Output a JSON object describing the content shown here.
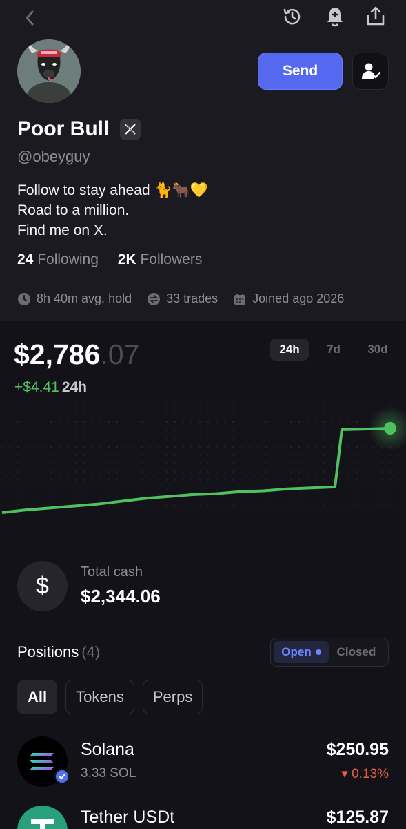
{
  "header": {
    "back_icon": "chevron-left-icon",
    "history_icon": "history-icon",
    "notify_icon": "bell-plus-icon",
    "share_icon": "share-icon"
  },
  "profile": {
    "send_label": "Send",
    "name": "Poor Bull",
    "handle": "@obeyguy",
    "bio": [
      "Follow to stay ahead 🐈🐂💛",
      "Road to a million.",
      "Find me on X."
    ],
    "following_count": "24",
    "following_label": "Following",
    "followers_count": "2K",
    "followers_label": "Followers",
    "avg_hold": "8h 40m avg. hold",
    "trades": "33 trades",
    "joined": "Joined ago 2026"
  },
  "portfolio": {
    "value_main": "$2,786",
    "value_cents": ".07",
    "change": "+$4.41",
    "change_period": "24h",
    "ranges": [
      "24h",
      "7d",
      "30d"
    ],
    "selected_range": "24h",
    "accent": "#4fc15e"
  },
  "chart_data": {
    "type": "line",
    "title": "",
    "xlabel": "",
    "ylabel": "",
    "series": [
      {
        "values": [
          2781.66,
          2781.8,
          2781.9,
          2782.0,
          2782.1,
          2782.25,
          2782.4,
          2782.5,
          2782.6,
          2782.65,
          2782.75,
          2782.8,
          2782.9,
          2782.95,
          2783.0,
          2786.0,
          2786.03,
          2786.07
        ]
      }
    ]
  },
  "cash": {
    "label": "Total cash",
    "value": "$2,344.06",
    "icon": "$"
  },
  "positions": {
    "title": "Positions",
    "count": "(4)",
    "toggle": {
      "open": "Open",
      "closed": "Closed"
    },
    "filters": [
      "All",
      "Tokens",
      "Perps"
    ],
    "items": [
      {
        "name": "Solana",
        "sub": "3.33 SOL",
        "value": "$250.95",
        "change": "▾ 0.13%"
      },
      {
        "name": "Tether USDt",
        "sub": "",
        "value": "$125.87",
        "change": ""
      }
    ]
  }
}
